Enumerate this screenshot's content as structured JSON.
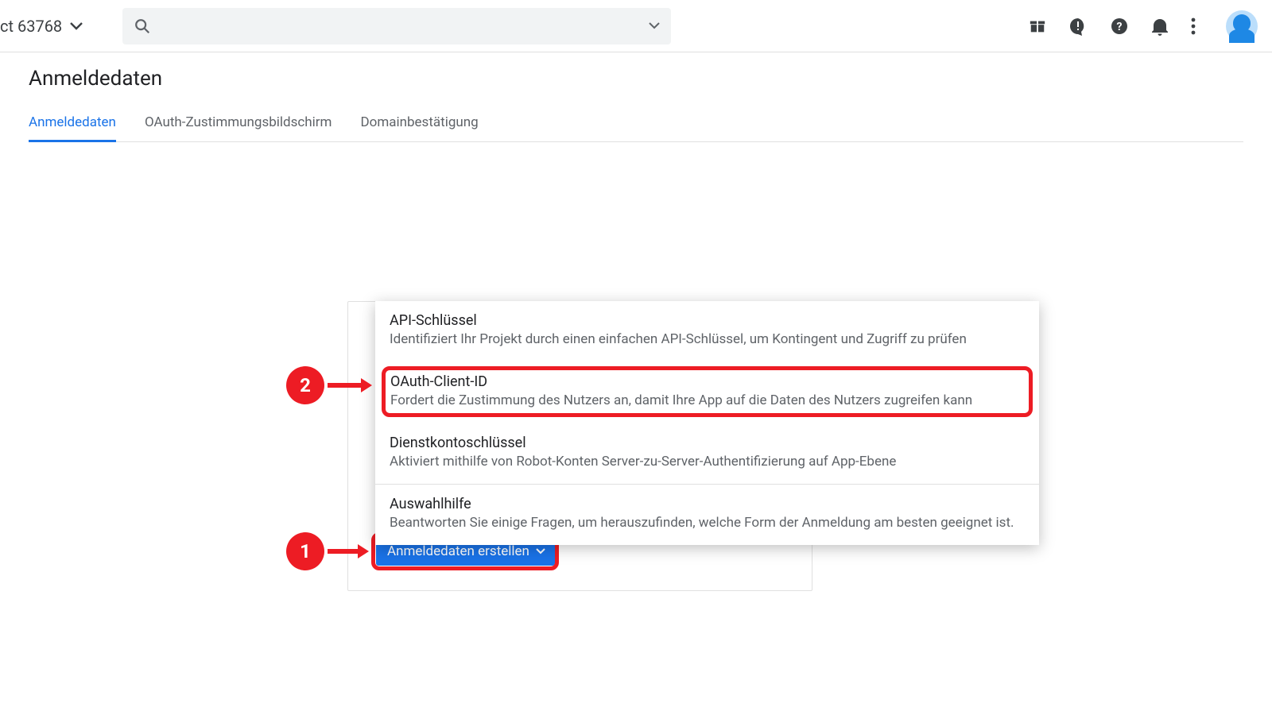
{
  "header": {
    "project_label": "ct 63768"
  },
  "page": {
    "title": "Anmeldedaten"
  },
  "tabs": [
    {
      "label": "Anmeldedaten",
      "active": true
    },
    {
      "label": "OAuth-Zustimmungsbildschirm",
      "active": false
    },
    {
      "label": "Domainbestätigung",
      "active": false
    }
  ],
  "create_button": {
    "label": "Anmeldedaten erstellen"
  },
  "popup": [
    {
      "title": "API-Schlüssel",
      "desc": "Identifiziert Ihr Projekt durch einen einfachen API-Schlüssel, um Kontingent und Zugriff zu prüfen"
    },
    {
      "title": "OAuth-Client-ID",
      "desc": "Fordert die Zustimmung des Nutzers an, damit Ihre App auf die Daten des Nutzers zugreifen kann"
    },
    {
      "title": "Dienstkontoschlüssel",
      "desc": "Aktiviert mithilfe von Robot-Konten Server-zu-Server-Authentifizierung auf App-Ebene"
    },
    {
      "title": "Auswahlhilfe",
      "desc": "Beantworten Sie einige Fragen, um herauszufinden, welche Form der Anmeldung am besten geeignet ist."
    }
  ],
  "steps": {
    "one": "1",
    "two": "2"
  }
}
